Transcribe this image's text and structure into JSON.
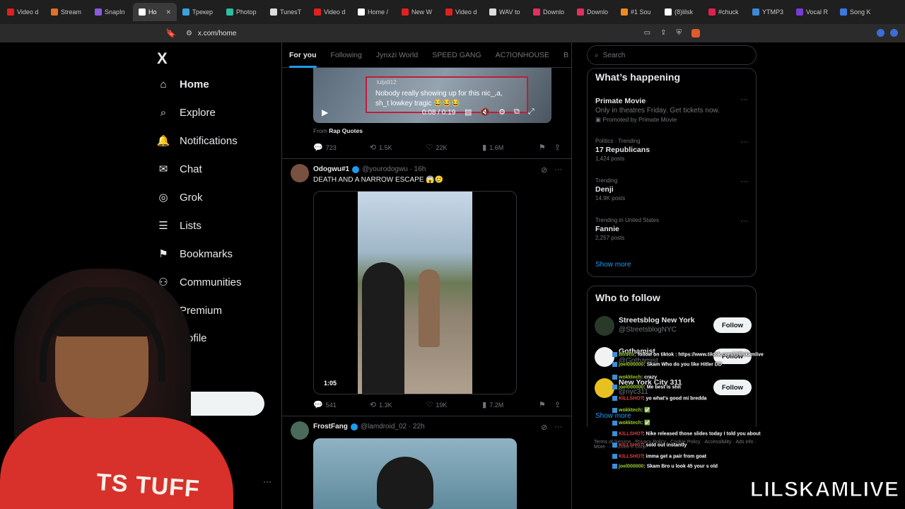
{
  "browser": {
    "tabs": [
      {
        "label": "Video d",
        "color": "#e02020"
      },
      {
        "label": "Stream",
        "color": "#e0702a"
      },
      {
        "label": "SnapIn",
        "color": "#8a5adf"
      },
      {
        "label": "Ho",
        "color": "#ffffff",
        "active": true
      },
      {
        "label": "Трекер",
        "color": "#3aa0e0"
      },
      {
        "label": "Photop",
        "color": "#2ac0a0"
      },
      {
        "label": "TunesT",
        "color": "#dddddd"
      },
      {
        "label": "Video d",
        "color": "#e02020"
      },
      {
        "label": "Home /",
        "color": "#ffffff"
      },
      {
        "label": "New W",
        "color": "#e02020"
      },
      {
        "label": "Video d",
        "color": "#e02020"
      },
      {
        "label": "WAV to",
        "color": "#dddddd"
      },
      {
        "label": "Downlo",
        "color": "#e03060"
      },
      {
        "label": "Downlo",
        "color": "#e03060"
      },
      {
        "label": "#1 Sou",
        "color": "#f08a20"
      },
      {
        "label": "(8)lilsk",
        "color": "#ffffff"
      },
      {
        "label": "#chuck",
        "color": "#e02050"
      },
      {
        "label": "YTMP3",
        "color": "#3a8ad8"
      },
      {
        "label": "Vocal R",
        "color": "#7a3ad8"
      },
      {
        "label": "Song K",
        "color": "#3a7ae0"
      }
    ],
    "url": "x.com/home"
  },
  "nav": {
    "logo": "X",
    "items": [
      {
        "label": "Home",
        "icon": "⌂"
      },
      {
        "label": "Explore",
        "icon": "⌕"
      },
      {
        "label": "Notifications",
        "icon": "🔔"
      },
      {
        "label": "Chat",
        "icon": "✉"
      },
      {
        "label": "Grok",
        "icon": "◎"
      },
      {
        "label": "Lists",
        "icon": "☰"
      },
      {
        "label": "Bookmarks",
        "icon": "⚑"
      },
      {
        "label": "Communities",
        "icon": "⚇"
      },
      {
        "label": "Premium",
        "icon": "✕"
      },
      {
        "label": "rofile",
        "icon": ""
      }
    ],
    "more": "···"
  },
  "feed": {
    "tabs": [
      "For you",
      "Following",
      "Jynxzi World",
      "SPEED GANG",
      "AC7IONHOUSE",
      "B"
    ],
    "post1": {
      "caption_user": "lulja912",
      "caption_line1": "Nobody really showing up for this nic_,a,",
      "caption_line2": "sh_t lowkey tragic 😂😂😂",
      "time": "0:08 / 0:19",
      "from_prefix": "From",
      "from_name": "Rap Quotes",
      "replies": "723",
      "reposts": "1.5K",
      "likes": "22K",
      "views": "1.6M"
    },
    "post2": {
      "name": "Odogwu#1",
      "handle": "@yourodogwu · 16h",
      "text": "DEATH AND A NARROW ESCAPE 😱🥲",
      "duration": "1:05",
      "replies": "541",
      "reposts": "1.3K",
      "likes": "19K",
      "views": "7.2M"
    },
    "post3": {
      "name": "FrostFang",
      "handle": "@lamdroid_02 · 22h"
    }
  },
  "sidebar": {
    "search_placeholder": "Search",
    "happening_title": "What’s happening",
    "trends": [
      {
        "context": "",
        "title": "Primate Movie",
        "desc": "Only in theatres Friday. Get tickets now.",
        "promo": "Promoted by Primate Movie"
      },
      {
        "context": "Politics · Trending",
        "title": "17 Republicans",
        "posts": "1,424 posts"
      },
      {
        "context": "Trending",
        "title": "Denji",
        "posts": "14.9K posts"
      },
      {
        "context": "Trending in United States",
        "title": "Fannie",
        "posts": "2,257 posts"
      }
    ],
    "show_more": "Show more",
    "who_title": "Who to follow",
    "accounts": [
      {
        "name": "Streetsblog New York",
        "handle": "@StreetsblogNYC",
        "button": "Follow"
      },
      {
        "name": "Gothamist",
        "handle": "@Gothamist",
        "button": "Follow"
      },
      {
        "name": "New York City 311",
        "handle": "@nyc311",
        "button": "Follow"
      }
    ],
    "show_more_2": "Show more",
    "footer": "Terms of Service  ·  Privacy Policy  ·  Cookie Policy  ·  Accessibility  ·  Ads info  ·  More ···  © 2026 X Corp."
  },
  "stream_chat": [
    {
      "user": "BotRix",
      "msg": ": follow on tiktok : https://www.tiktok.com/@lilskamlive",
      "red": false
    },
    {
      "user": "joel000000",
      "msg": ": Skam Who do you like Hitler DD",
      "red": false
    },
    {
      "user": "wokktech",
      "msg": ": crazy",
      "red": false
    },
    {
      "user": "joel000000",
      "msg": ": Me best is shit",
      "red": false
    },
    {
      "user": "KILLSHOT",
      "msg": ": yo what's good mi bredda",
      "red": true
    },
    {
      "user": "wokktech",
      "msg": ": ✅",
      "red": false
    },
    {
      "user": "wokktech",
      "msg": ": ✅",
      "red": false
    },
    {
      "user": "KILLSHOT",
      "msg": ": Nike released those slides today I told you about",
      "red": true
    },
    {
      "user": "KILLSHOT",
      "msg": ": sold out instantly",
      "red": true
    },
    {
      "user": "KILLSHOT",
      "msg": ": imma get a pair from goat",
      "red": true
    },
    {
      "user": "joel000000",
      "msg": ": Skam Bro u look 45 your s old",
      "red": false
    }
  ],
  "webcam": {
    "shirt_text": "TS TUFF"
  },
  "overlay_brand": "LILSKAMLIVE"
}
